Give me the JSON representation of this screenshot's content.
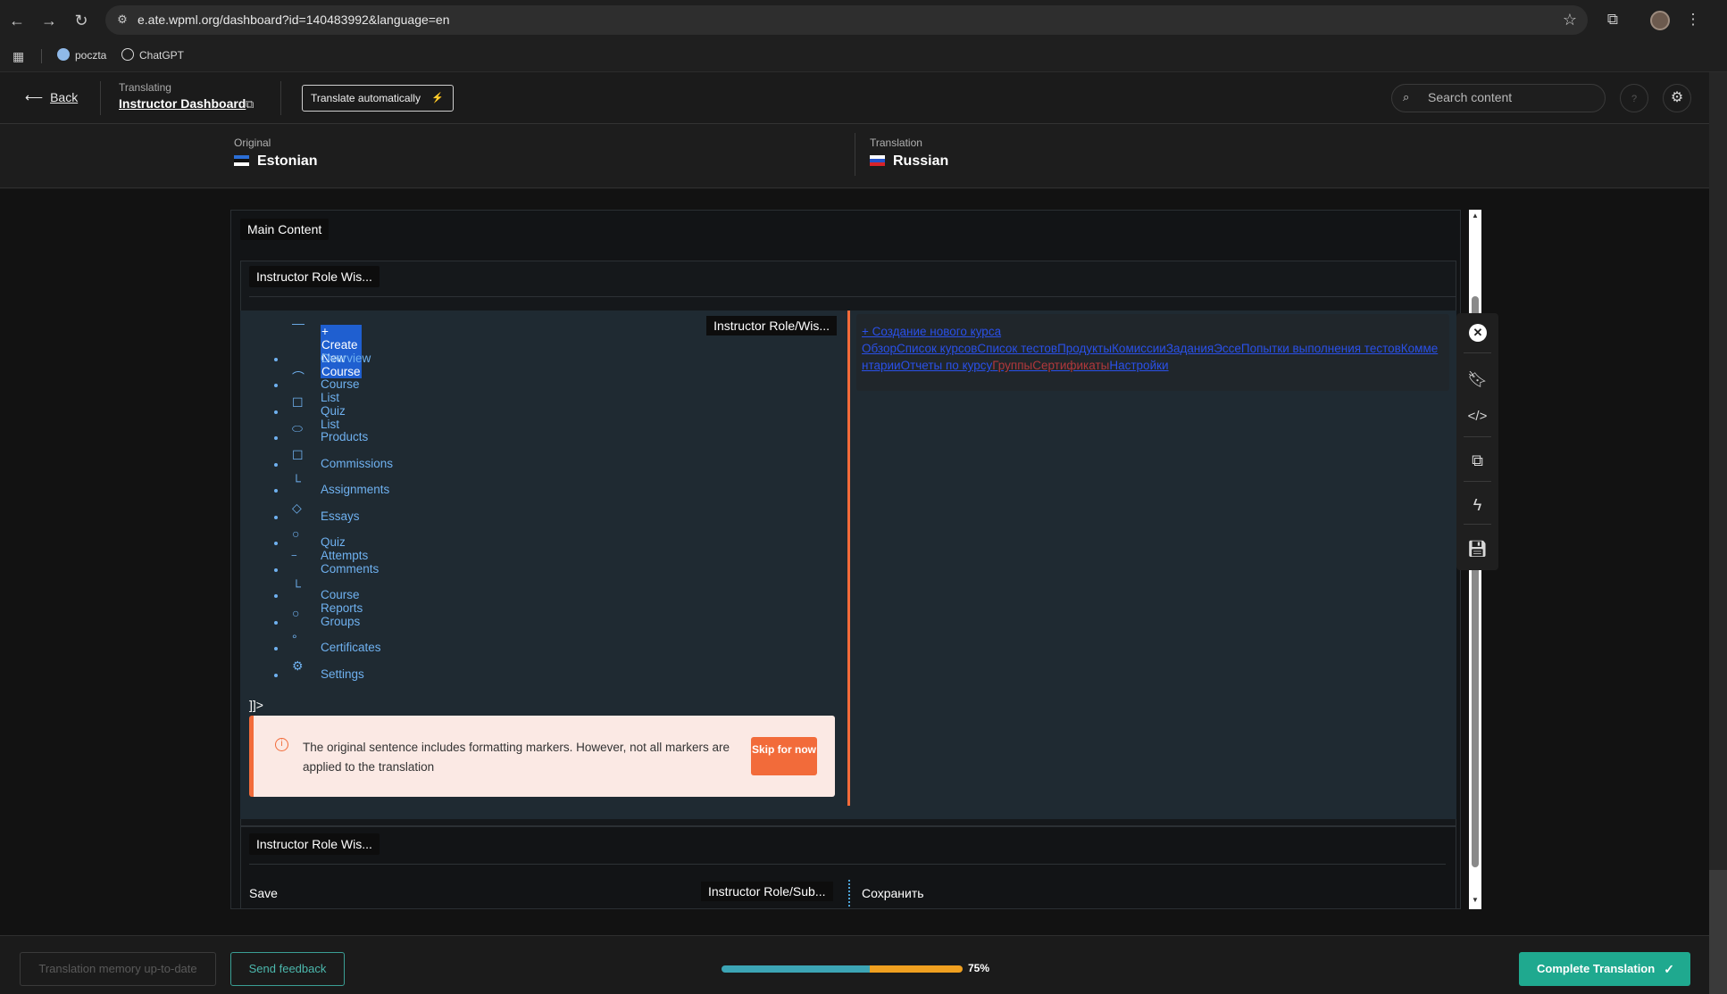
{
  "browser": {
    "url": "e.ate.wpml.org/dashboard?id=140483992&language=en",
    "bookmarks": [
      {
        "label": "poczta",
        "icon": "poczta-icon"
      },
      {
        "label": "ChatGPT",
        "icon": "chatgpt-icon"
      }
    ]
  },
  "header": {
    "back_label": "Back",
    "translating_label": "Translating",
    "dashboard_title": "Instructor Dashboard",
    "translate_auto_label": "Translate automatically",
    "search_placeholder": "Search content"
  },
  "languages": {
    "original_label": "Original",
    "original_name": "Estonian",
    "translation_label": "Translation",
    "translation_name": "Russian"
  },
  "panel": {
    "main_tag": "Main Content",
    "section_tag": "Instructor Role Wis...",
    "ref_tag": "Instructor Role/Wis...",
    "marker_end": "]]>",
    "menu": [
      {
        "label": "+ Create New Course",
        "marker": "—",
        "bullet": false,
        "highlight": true
      },
      {
        "label": "Overview",
        "marker": "",
        "bullet": true
      },
      {
        "label": "Course List",
        "marker": "⌒",
        "bullet": true
      },
      {
        "label": "Quiz List",
        "marker": "☐",
        "bullet": true
      },
      {
        "label": "Products",
        "marker": "⬭",
        "bullet": true
      },
      {
        "label": "Commissions",
        "marker": "☐",
        "bullet": true
      },
      {
        "label": "Assignments",
        "marker": "└",
        "bullet": true
      },
      {
        "label": "Essays",
        "marker": "◇",
        "bullet": true
      },
      {
        "label": "Quiz Attempts",
        "marker": "○",
        "bullet": true
      },
      {
        "label": "Comments",
        "marker": "‾",
        "bullet": true
      },
      {
        "label": "Course Reports",
        "marker": "└",
        "bullet": true
      },
      {
        "label": "Groups",
        "marker": "○",
        "bullet": true
      },
      {
        "label": "Certificates",
        "marker": "°",
        "bullet": true
      },
      {
        "label": "Settings",
        "marker": "⚙",
        "bullet": true
      }
    ],
    "warning_text": "The original sentence includes formatting markers. However, not all markers are applied to the translation",
    "skip_label": "Skip for now",
    "translation_line1": "+ Создание нового курса",
    "translation_line2a": "ОбзорСписок курсовСписок тестовПродуктыКомиссииЗаданияЭссеПопытки выполнения тестовКомментарииОтчеты по курсу",
    "translation_line2b": "ГруппыСертификаты",
    "translation_line2c": "Настройки",
    "section2_tag": "Instructor Role Wis...",
    "save_original": "Save",
    "sub_ref_tag": "Instructor Role/Sub...",
    "save_translation": "Сохранить"
  },
  "toolbar_icons": [
    "close-icon",
    "bookmark-icon",
    "code-icon",
    "copy-icon",
    "bolt-icon",
    "save-icon"
  ],
  "footer": {
    "tm_label": "Translation memory up-to-date",
    "feedback_label": "Send feedback",
    "progress": 0.75,
    "progress_label": "75%",
    "complete_label": "Complete Translation"
  },
  "colors": {
    "accent_orange": "#f26b3a",
    "accent_teal": "#1fa98f",
    "link_blue": "#6fb1f0"
  }
}
